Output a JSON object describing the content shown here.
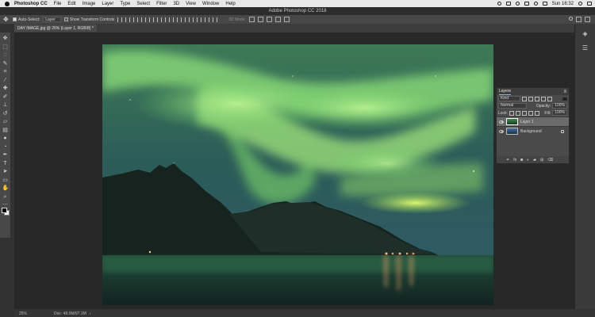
{
  "menubar": {
    "app_name": "Photoshop CC",
    "items": [
      "File",
      "Edit",
      "Image",
      "Layer",
      "Type",
      "Select",
      "Filter",
      "3D",
      "View",
      "Window",
      "Help"
    ],
    "clock": "Sun 16:32"
  },
  "window": {
    "title": "Adobe Photoshop CC 2018"
  },
  "options_bar": {
    "auto_select_label": "Auto-Select:",
    "auto_select_value": "Layer",
    "transform_label": "Show Transform Controls",
    "mode_3d_label": "3D Mode:"
  },
  "document": {
    "tab_label": "DAY IMAGE.jpg @ 25% (Layer 1, RGB/8) *",
    "zoom": "25%",
    "doc_size": "Doc: 48.0M/97.1M"
  },
  "layers_panel": {
    "title": "Layers",
    "filter_value": "Kind",
    "blend_mode": "Normal",
    "opacity_label": "Opacity:",
    "opacity_value": "100%",
    "lock_label": "Lock:",
    "fill_label": "Fill:",
    "fill_value": "100%",
    "layers": [
      {
        "name": "Layer 1",
        "selected": true,
        "thumb": "aurora"
      },
      {
        "name": "Background",
        "selected": false,
        "thumb": "sky",
        "locked": true
      }
    ],
    "footer_icons": [
      "link-icon",
      "fx-icon",
      "mask-icon",
      "adjustment-icon",
      "folder-icon",
      "new-layer-icon",
      "trash-icon"
    ]
  },
  "colors": {
    "menubar_bg": "#e8e8e8",
    "ui_dark": "#323232",
    "panel_bg": "#4a4a4a",
    "aurora_green": "#7fdc6a",
    "sky": "#2f5864"
  }
}
